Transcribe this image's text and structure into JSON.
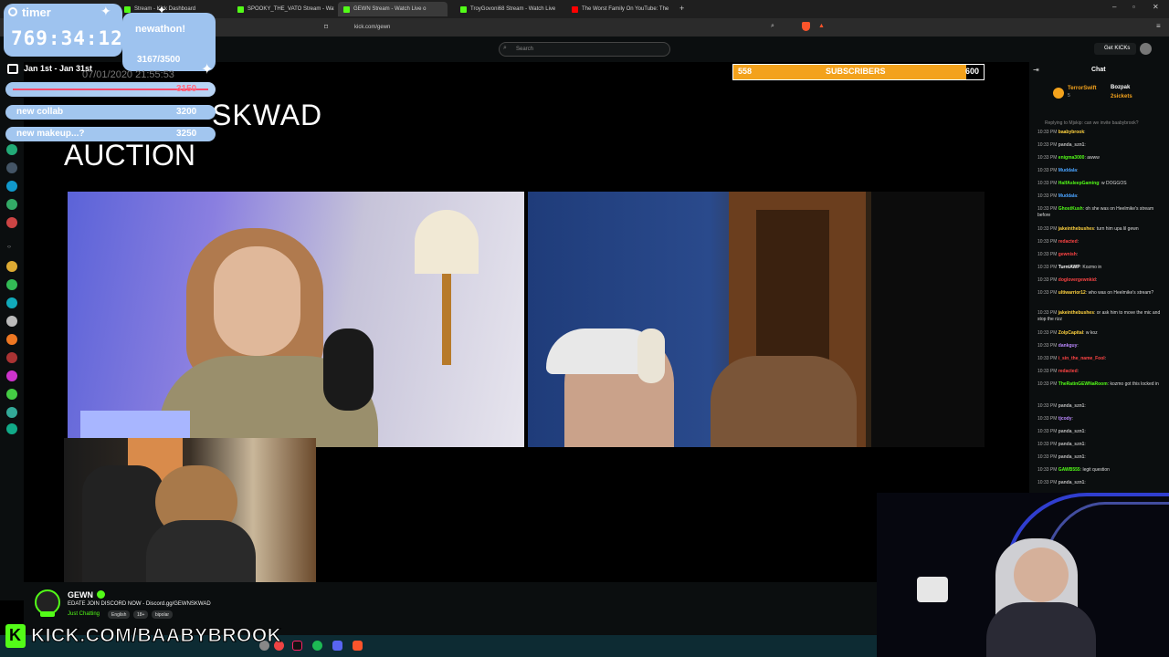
{
  "browser": {
    "tabs": [
      {
        "label": "Stream - Kick Dashboard",
        "color": "#53fc18"
      },
      {
        "label": "SPOOKY_THE_VATO Stream - Watch",
        "color": "#53fc18"
      },
      {
        "label": "GEWN Stream - Watch Live o",
        "color": "#53fc18"
      },
      {
        "label": "TroyGovoni68 Stream - Watch Live o",
        "color": "#53fc18"
      },
      {
        "label": "The Worst Family On YouTube: The",
        "color": "#ff0000"
      }
    ],
    "url": "kick.com/gewn"
  },
  "site": {
    "search_placeholder": "Search",
    "get_kicks": "Get KICKs"
  },
  "overlay": {
    "timer_label": "timer",
    "timer_value": "769:34:12",
    "newathon_title": "newathon!",
    "newathon_progress": "3167/3500",
    "date_range": "Jan 1st - Jan 31st",
    "stream_date": "07/01/2020 21:55:53",
    "goals": [
      {
        "name": "",
        "amount": "3150"
      },
      {
        "name": "new collab",
        "amount": "3200"
      },
      {
        "name": "new makeup...?",
        "amount": "3250"
      }
    ],
    "kick_url": "KICK.COM/BAABYBROOK"
  },
  "stream": {
    "auction_line1": "SKWAD",
    "auction_line2": "AUCTION",
    "subscribers": {
      "current": "558",
      "label": "SUBSCRIBERS",
      "goal": "600",
      "progress": 0.93
    }
  },
  "channel": {
    "name": "GEWN",
    "title": "EDATE JOIN DISCORD NOW - Discord.gg/GEWNSKWAD",
    "category": "Just Chatting",
    "tags": [
      "English",
      "18+",
      "bipolar"
    ]
  },
  "chat": {
    "title": "Chat",
    "pinned": [
      {
        "user": "TerrorSwift",
        "count": "5"
      },
      {
        "user": "Bozpak",
        "count": "1"
      },
      {
        "user": "2sickets",
        "count": "1"
      }
    ],
    "replying": "Replying to Mjskip: can we invite baabybrook?",
    "messages": [
      {
        "time": "10:33 PM",
        "user": "baabybrook",
        "color": "#ffd23f",
        "text": ""
      },
      {
        "time": "10:33 PM",
        "user": "panda_szn1",
        "color": "#bbbbbb",
        "text": ""
      },
      {
        "time": "10:33 PM",
        "user": "enigma3000",
        "color": "#53fc18",
        "text": "awww"
      },
      {
        "time": "10:33 PM",
        "user": "Muddala",
        "color": "#4aa3ff",
        "text": ""
      },
      {
        "time": "10:33 PM",
        "user": "HalfAsleepGaming",
        "color": "#53fc18",
        "text": "w DOGGOS"
      },
      {
        "time": "10:33 PM",
        "user": "Muddala",
        "color": "#4aa3ff",
        "text": ""
      },
      {
        "time": "10:33 PM",
        "user": "GhostKush",
        "color": "#53fc18",
        "text": "oh she was on Heelmike's stream before"
      },
      {
        "time": "10:33 PM",
        "user": "jakeinthebushes",
        "color": "#ffd23f",
        "text": "turn him upa lil gewn"
      },
      {
        "time": "10:33 PM",
        "user": "redacted",
        "color": "#ff4444",
        "text": ""
      },
      {
        "time": "10:33 PM",
        "user": "gewnish",
        "color": "#ff4444",
        "text": ""
      },
      {
        "time": "10:33 PM",
        "user": "TurntAWP",
        "color": "#ffffff",
        "text": "Kozmo in"
      },
      {
        "time": "10:33 PM",
        "user": "doglovergewnkid",
        "color": "#ff4444",
        "text": ""
      },
      {
        "time": "10:33 PM",
        "user": "ultiwarrior12",
        "color": "#ffd23f",
        "text": "who was on Heelmike's stream?"
      },
      {
        "time": "10:33 PM",
        "user": "jakeinthebushes",
        "color": "#ffd23f",
        "text": "or ask him to move the mic and stop the rizz"
      },
      {
        "time": "10:33 PM",
        "user": "ZolpCapital",
        "color": "#ffd23f",
        "text": "w koz"
      },
      {
        "time": "10:33 PM",
        "user": "dankguy",
        "color": "#bb88ff",
        "text": ""
      },
      {
        "time": "10:33 PM",
        "user": "i_sin_the_name_Fool",
        "color": "#ff4444",
        "text": ""
      },
      {
        "time": "10:33 PM",
        "user": "redacted",
        "color": "#ff4444",
        "text": ""
      },
      {
        "time": "10:33 PM",
        "user": "TheRatinGEWNaRoom",
        "color": "#53fc18",
        "text": "kozmo got this locked in"
      },
      {
        "time": "10:33 PM",
        "user": "panda_szn1",
        "color": "#bbbbbb",
        "text": ""
      },
      {
        "time": "10:33 PM",
        "user": "tjcody",
        "color": "#bb88ff",
        "text": ""
      },
      {
        "time": "10:33 PM",
        "user": "panda_szn1",
        "color": "#bbbbbb",
        "text": ""
      },
      {
        "time": "10:33 PM",
        "user": "panda_szn1",
        "color": "#bbbbbb",
        "text": ""
      },
      {
        "time": "10:33 PM",
        "user": "panda_szn1",
        "color": "#bbbbbb",
        "text": ""
      },
      {
        "time": "10:33 PM",
        "user": "GAWB555",
        "color": "#53fc18",
        "text": "legit question"
      },
      {
        "time": "10:33 PM",
        "user": "panda_szn1",
        "color": "#bbbbbb",
        "text": ""
      }
    ]
  }
}
